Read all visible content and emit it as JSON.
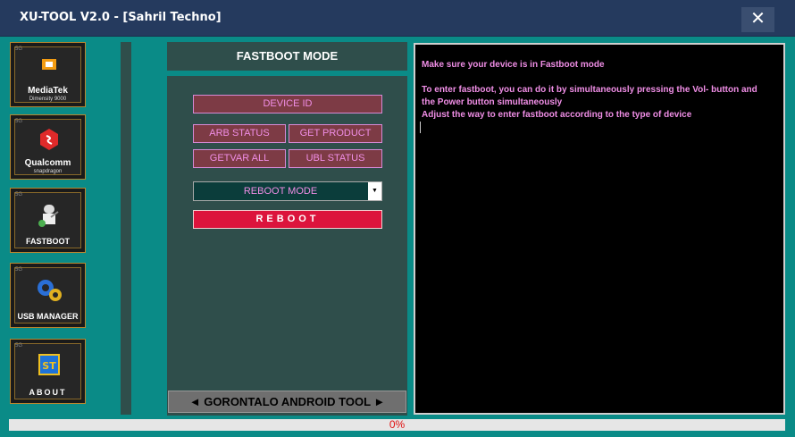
{
  "window": {
    "title": "XU-TOOL V2.0 - [Sahril Techno]",
    "close_glyph": "✕"
  },
  "sidebar": {
    "items": [
      {
        "name": "mediatek",
        "tag": "5G",
        "label": "MediaTek",
        "sub": "Dimensity 9000",
        "icon": "mediatek-chip-icon"
      },
      {
        "name": "qualcomm",
        "tag": "5G",
        "label": "Qualcomm",
        "sub": "snapdragon",
        "icon": "snapdragon-icon"
      },
      {
        "name": "fastboot",
        "tag": "5G",
        "label": "FASTBOOT",
        "sub": "",
        "icon": "android-robot-icon"
      },
      {
        "name": "usb-manager",
        "tag": "5G",
        "label": "USB MANAGER",
        "sub": "",
        "icon": "gears-icon"
      },
      {
        "name": "about",
        "tag": "5G",
        "label": "ABOUT",
        "sub": "",
        "icon": "chip-st-icon"
      }
    ]
  },
  "panel": {
    "header": "FASTBOOT MODE",
    "device_id": "DEVICE ID",
    "arb_status": "ARB STATUS",
    "get_product": "GET PRODUCT",
    "getvar_all": "GETVAR ALL",
    "ubl_status": "UBL STATUS",
    "reboot_mode": {
      "selected": "REBOOT MODE"
    },
    "reboot": "REBOOT",
    "footer": "◄ GORONTALO ANDROID TOOL ►"
  },
  "console": {
    "lines": [
      "Make sure your device is in Fastboot mode",
      "To enter fastboot, you can do it by simultaneously pressing the Vol- button and",
      "the Power button simultaneously",
      "Adjust the way to enter fastboot according to the type of device"
    ]
  },
  "progress": {
    "value": 0,
    "label": "0%"
  },
  "colors": {
    "background": "#0a8b87",
    "titlebar": "#253a5e",
    "panel": "#2f4e4b",
    "button_text": "#f08ee6",
    "reboot": "#dc143c",
    "progress_text": "#e01010"
  }
}
